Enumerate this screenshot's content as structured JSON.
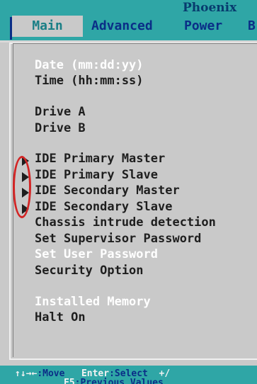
{
  "vendor": "Phoenix",
  "menu": {
    "items": [
      "Main",
      "Advanced",
      "Power",
      "B"
    ],
    "selected": "Main"
  },
  "rows": [
    {
      "label": "Date (mm:dd:yy)",
      "submenu": false
    },
    {
      "label": "Time (hh:mm:ss)",
      "submenu": false
    },
    {
      "label": "Drive A",
      "submenu": false
    },
    {
      "label": "Drive B",
      "submenu": false
    },
    {
      "label": "IDE Primary Master",
      "submenu": true
    },
    {
      "label": "IDE Primary Slave",
      "submenu": true
    },
    {
      "label": "IDE Secondary Master",
      "submenu": true
    },
    {
      "label": "IDE Secondary Slave",
      "submenu": true
    },
    {
      "label": "Chassis intrude detection",
      "submenu": false
    },
    {
      "label": "Set Supervisor Password",
      "submenu": false
    },
    {
      "label": "Set User Password",
      "submenu": false
    },
    {
      "label": "Security Option",
      "submenu": false
    },
    {
      "label": "Installed Memory",
      "submenu": false
    },
    {
      "label": "Halt On",
      "submenu": false
    }
  ],
  "footer": {
    "move_arrows": "↑↓→←",
    "move_label": ":Move",
    "enter_key": "Enter",
    "enter_desc": ":Select",
    "plus_minus": "+/",
    "f5_key": "F5",
    "f5_desc": ":Previous Values"
  },
  "colors": {
    "bar_bg": "#2fa6a6",
    "panel_bg": "#c9c9c9",
    "menu_text": "#0a2e87",
    "selected_tab_text": "#1a7f86",
    "row_white": "#ffffff",
    "row_dark": "#1e1e1e",
    "annotation_oval": "#d32424"
  },
  "icons": {
    "submenu": "triangle-right-icon",
    "annotation": "red-oval-highlight"
  }
}
